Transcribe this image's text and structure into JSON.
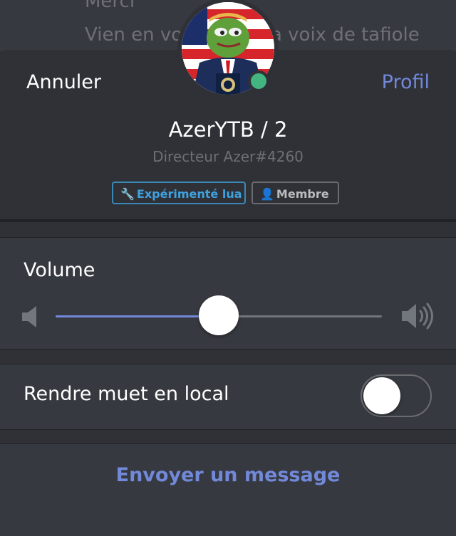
{
  "chat": {
    "line1": "Merci",
    "line2": "Vien en vocal pour ta voix de tafiole"
  },
  "header": {
    "cancel_label": "Annuler",
    "profile_label": "Profil"
  },
  "user": {
    "display_name": "AzerYTB / 2",
    "tag": "Directeur Azer#4260",
    "status": "online",
    "status_color": "#43b581"
  },
  "roles": [
    {
      "label": "Expérimenté lua",
      "icon": "wrench-icon",
      "color": "#3fa2e0"
    },
    {
      "label": "Membre",
      "icon": "person-icon",
      "color": "#b9bbbe"
    }
  ],
  "volume": {
    "label": "Volume",
    "level_percent": 50
  },
  "local_mute": {
    "label": "Rendre muet en local",
    "enabled": false
  },
  "actions": {
    "send_message_label": "Envoyer un message"
  },
  "colors": {
    "accent": "#7289da",
    "background": "#2f3136",
    "panel": "#36393f"
  }
}
